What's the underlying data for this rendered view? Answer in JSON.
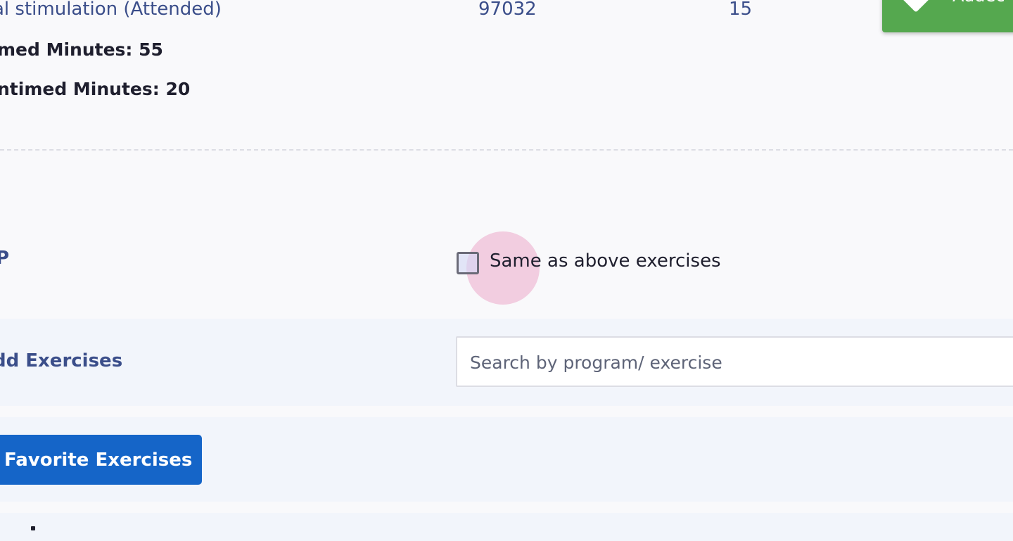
{
  "service_row": {
    "name": "al stimulation (Attended)",
    "code": "97032",
    "units": "15"
  },
  "totals": {
    "timed": "med Minutes: 55",
    "untimed": "ntimed Minutes: 20"
  },
  "toast": {
    "text": "Addec",
    "icon": "diamond-check-icon",
    "color": "#55a84f"
  },
  "section_mark": "P",
  "same_as_above": {
    "label": "Same as above exercises",
    "checked": false
  },
  "add_exercises": {
    "label": "dd Exercises",
    "search_placeholder": "Search by program/ exercise",
    "search_value": ""
  },
  "favorite_button": {
    "label": "Favorite Exercises",
    "color": "#1565c8"
  }
}
